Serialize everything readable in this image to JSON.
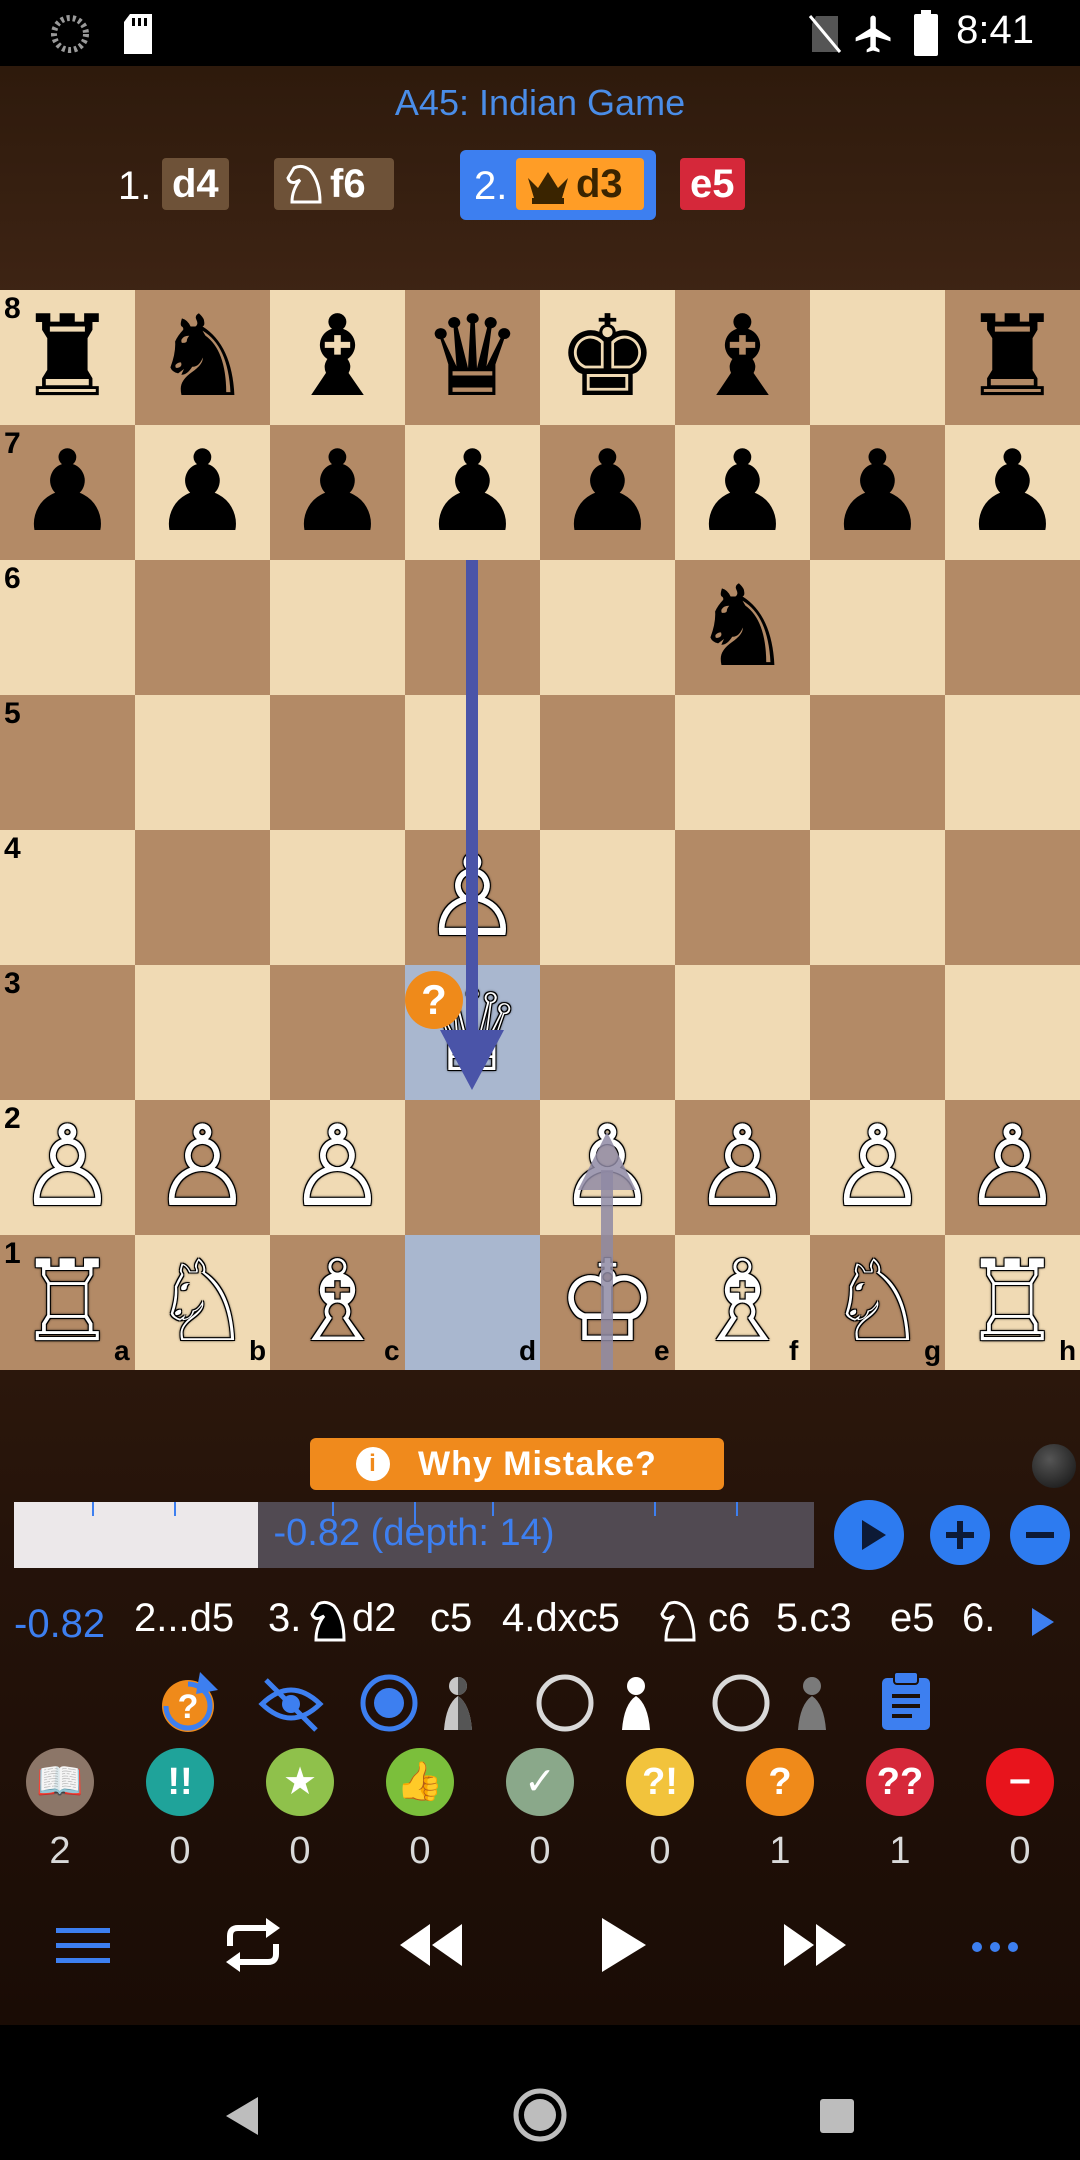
{
  "status_bar": {
    "time": "8:41",
    "icons": [
      "loading-icon",
      "sd-card-icon",
      "no-sim-icon",
      "airplane-mode-icon",
      "battery-icon"
    ]
  },
  "opening": "A45: Indian Game",
  "moves": {
    "m1_num": "1.",
    "m1_white": "d4",
    "m1_black": "f6",
    "m2_num": "2.",
    "m2_white": "d3",
    "m2_black": "e5"
  },
  "board": {
    "ranks": [
      "8",
      "7",
      "6",
      "5",
      "4",
      "3",
      "2",
      "1"
    ],
    "files": [
      "a",
      "b",
      "c",
      "d",
      "e",
      "f",
      "g",
      "h"
    ],
    "pieces": {
      "a8": "♜",
      "b8": "♞",
      "c8": "♝",
      "d8": "♛",
      "e8": "♚",
      "f8": "♝",
      "h8": "♜",
      "a7": "♟",
      "b7": "♟",
      "c7": "♟",
      "d7": "♟",
      "e7": "♟",
      "f7": "♟",
      "g7": "♟",
      "h7": "♟",
      "f6": "♞",
      "d4": "♙",
      "d3": "♕",
      "a2": "♙",
      "b2": "♙",
      "c2": "♙",
      "e2": "♙",
      "f2": "♙",
      "g2": "♙",
      "h2": "♙",
      "a1": "♖",
      "b1": "♘",
      "c1": "♗",
      "e1": "♔",
      "f1": "♗",
      "g1": "♘",
      "h1": "♖"
    },
    "mistake_badge": "?"
  },
  "why_mistake": "Why Mistake?",
  "eval": {
    "text": "-0.82 (depth: 14)",
    "bar_fraction": 0.305
  },
  "pv": {
    "score": "-0.82",
    "moves": [
      "2...d5",
      "3.",
      "d2",
      "c5",
      "4.dxc5",
      "c6",
      "5.c3",
      "e5",
      "6."
    ]
  },
  "annotations": [
    {
      "icon": "book-icon",
      "label": "📖",
      "count": "2",
      "color": "#8c7668"
    },
    {
      "icon": "brilliant-icon",
      "label": "!!",
      "count": "0",
      "color": "#1fa39a"
    },
    {
      "icon": "best-star-icon",
      "label": "★",
      "count": "0",
      "color": "#8fc14b"
    },
    {
      "icon": "good-thumb-icon",
      "label": "👍",
      "count": "0",
      "color": "#7bbf3b"
    },
    {
      "icon": "ok-check-icon",
      "label": "✓",
      "count": "0",
      "color": "#8aa88a"
    },
    {
      "icon": "dubious-icon",
      "label": "?!",
      "count": "0",
      "color": "#f2c33c"
    },
    {
      "icon": "mistake-icon",
      "label": "?",
      "count": "1",
      "color": "#ef8a1a"
    },
    {
      "icon": "blunder-icon",
      "label": "??",
      "count": "1",
      "color": "#d6283a"
    },
    {
      "icon": "missed-icon",
      "label": "−",
      "count": "0",
      "color": "#e8141c"
    }
  ],
  "colors": {
    "accent": "#3d7ff0",
    "light_square": "#f0dab4",
    "dark_square": "#b38a66",
    "highlight": "#a9b7cf",
    "orange": "#f08a1c"
  }
}
